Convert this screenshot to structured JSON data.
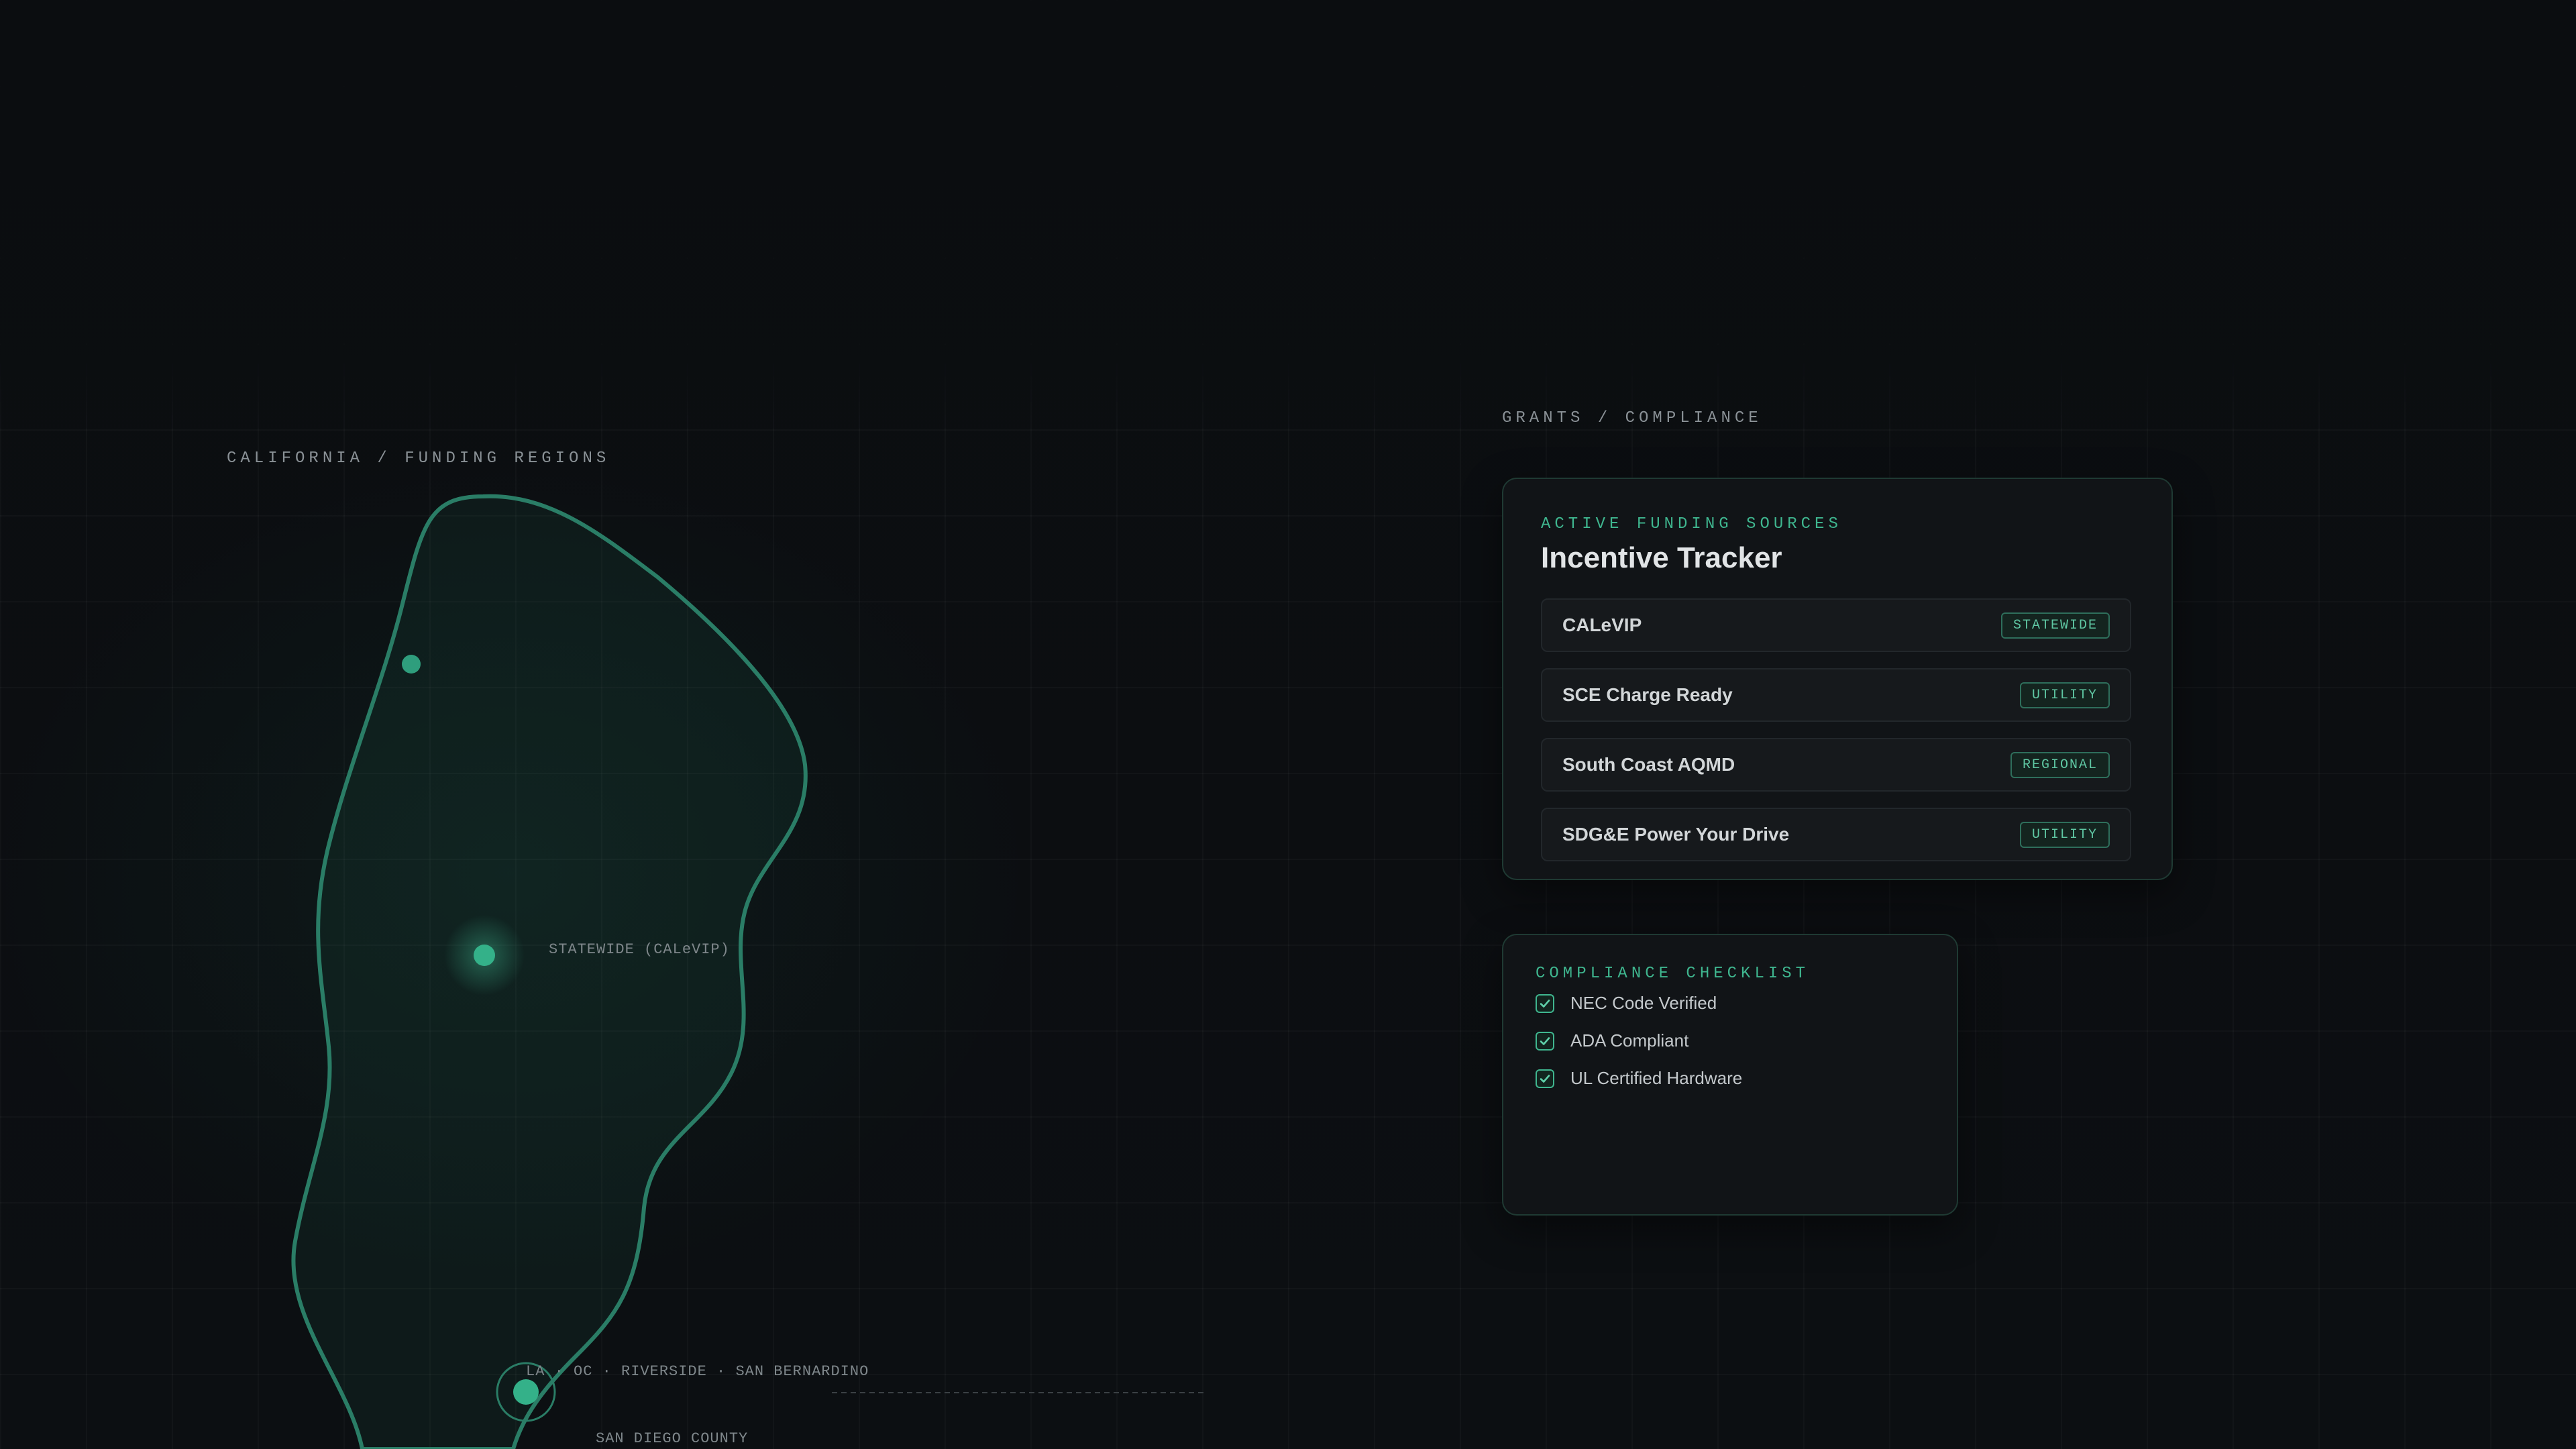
{
  "map": {
    "section_label": "CALIFORNIA / FUNDING REGIONS",
    "regions": [
      {
        "label": "STATEWIDE (CALeVIP)"
      },
      {
        "label": "LA · OC · RIVERSIDE · SAN BERNARDINO"
      },
      {
        "label": "SAN DIEGO COUNTY"
      }
    ]
  },
  "grants": {
    "section_label": "GRANTS / COMPLIANCE",
    "tracker": {
      "eyebrow": "ACTIVE FUNDING SOURCES",
      "title": "Incentive Tracker",
      "sources": [
        {
          "name": "CALeVIP",
          "badge": "STATEWIDE"
        },
        {
          "name": "SCE Charge Ready",
          "badge": "UTILITY"
        },
        {
          "name": "South Coast AQMD",
          "badge": "REGIONAL"
        },
        {
          "name": "SDG&E Power Your Drive",
          "badge": "UTILITY"
        }
      ]
    },
    "checklist": {
      "title": "COMPLIANCE CHECKLIST",
      "items": [
        {
          "label": "NEC Code Verified",
          "checked": true
        },
        {
          "label": "ADA Compliant",
          "checked": true
        },
        {
          "label": "UL Certified Hardware",
          "checked": true
        }
      ]
    }
  },
  "colors": {
    "accent": "#3fb68f",
    "background": "#0b0d10",
    "card": "#111417"
  }
}
